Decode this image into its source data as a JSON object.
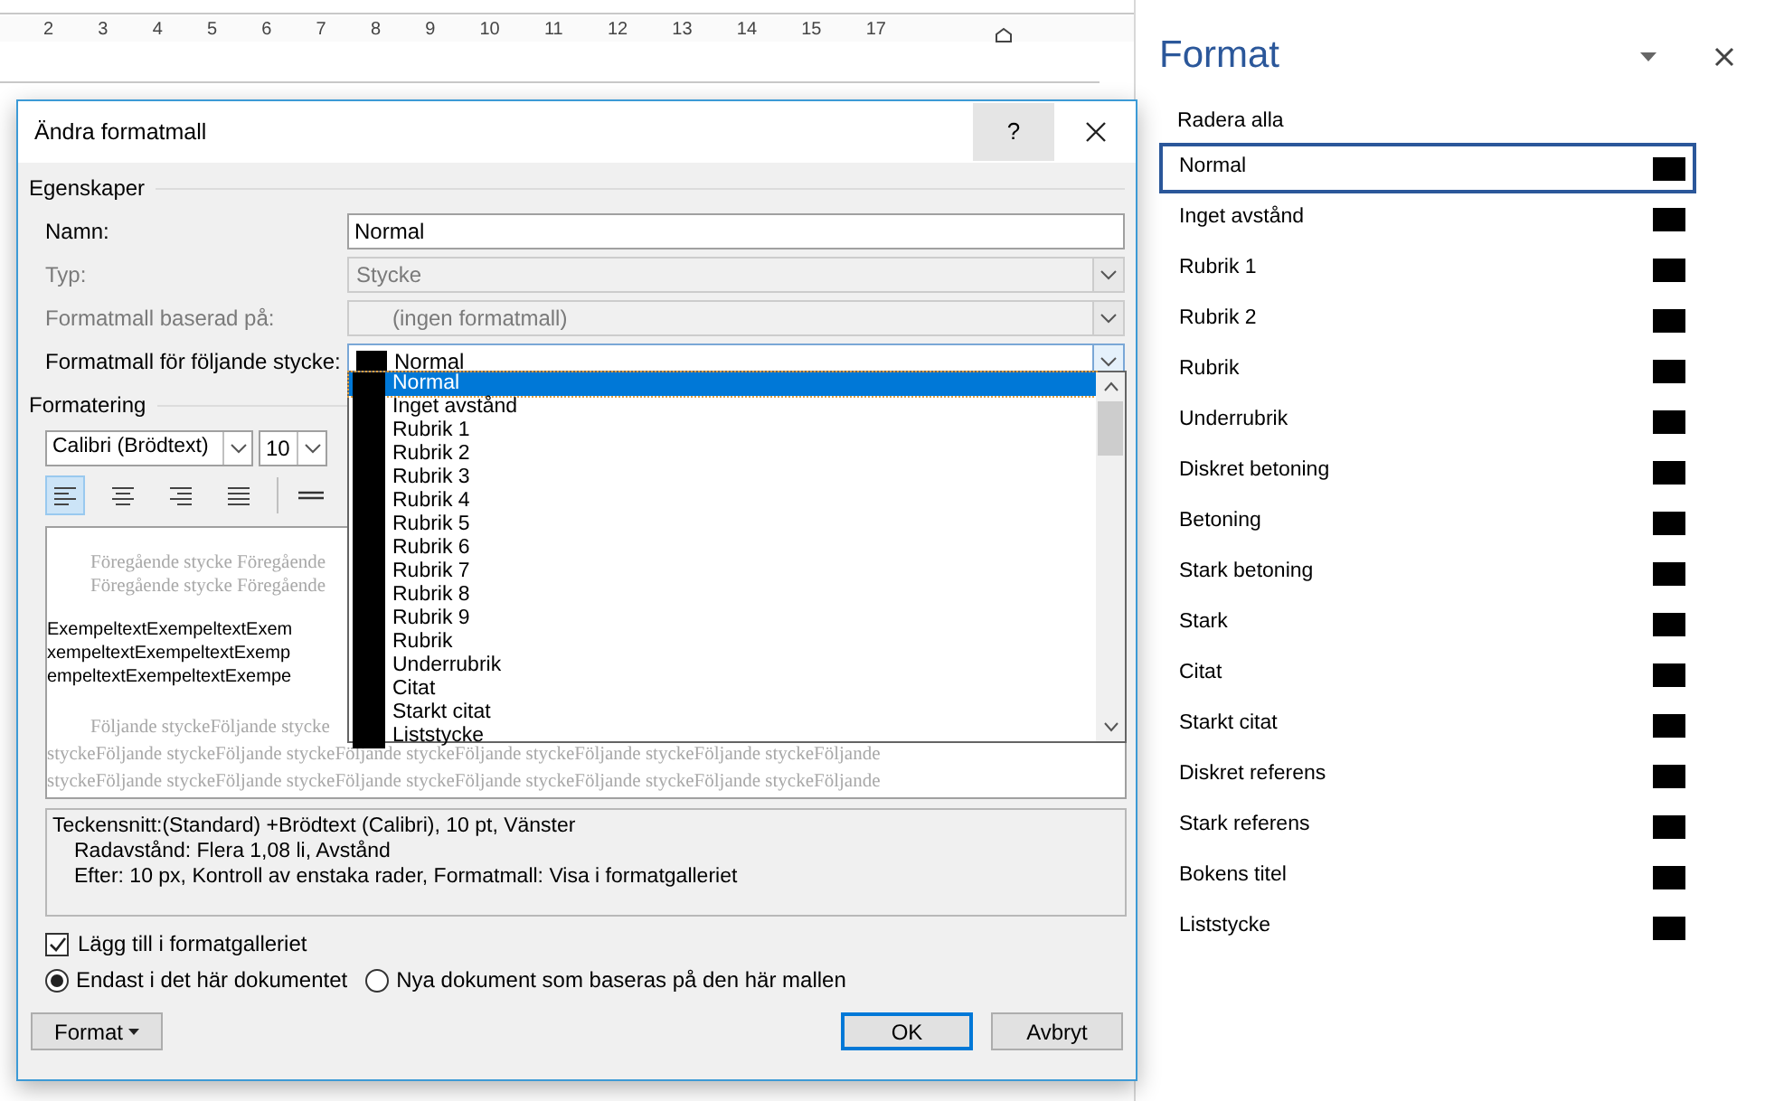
{
  "ruler": {
    "ticks": [
      "2",
      "3",
      "4",
      "5",
      "6",
      "7",
      "8",
      "9",
      "10",
      "11",
      "12",
      "13",
      "14",
      "15",
      "17"
    ]
  },
  "dialog": {
    "title": "Ändra formatmall",
    "help_button": "?",
    "properties": {
      "heading": "Egenskaper",
      "fields": [
        {
          "label": "Namn:",
          "value": "Normal",
          "kind": "text",
          "disabled": false
        },
        {
          "label": "Typ:",
          "value": "Stycke",
          "kind": "combo",
          "disabled": true
        },
        {
          "label": "Formatmall baserad på:",
          "value": "(ingen formatmall)",
          "kind": "combo",
          "disabled": true
        },
        {
          "label": "Formatmall för följande stycke:",
          "value": "Normal",
          "kind": "style-combo",
          "disabled": false
        }
      ]
    },
    "dropdown": {
      "items": [
        {
          "label": "Normal",
          "selected": true
        },
        {
          "label": "Inget avstånd",
          "selected": false
        },
        {
          "label": "Rubrik 1",
          "selected": false
        },
        {
          "label": "Rubrik 2",
          "selected": false
        },
        {
          "label": "Rubrik 3",
          "selected": false
        },
        {
          "label": "Rubrik 4",
          "selected": false
        },
        {
          "label": "Rubrik 5",
          "selected": false
        },
        {
          "label": "Rubrik 6",
          "selected": false
        },
        {
          "label": "Rubrik 7",
          "selected": false
        },
        {
          "label": "Rubrik 8",
          "selected": false
        },
        {
          "label": "Rubrik 9",
          "selected": false
        },
        {
          "label": "Rubrik",
          "selected": false
        },
        {
          "label": "Underrubrik",
          "selected": false
        },
        {
          "label": "Citat",
          "selected": false
        },
        {
          "label": "Starkt citat",
          "selected": false
        },
        {
          "label": "Liststycke",
          "selected": false
        }
      ]
    },
    "formatting": {
      "heading": "Formatering",
      "font": "Calibri (Brödtext)",
      "size": "10",
      "align_buttons": [
        {
          "kind": "left",
          "selected": true
        },
        {
          "kind": "center",
          "selected": false
        },
        {
          "kind": "right",
          "selected": false
        },
        {
          "kind": "justify",
          "selected": false
        }
      ]
    },
    "preview": {
      "lines": [
        {
          "kind": "previous",
          "text": "Föregående stycke Föregående"
        },
        {
          "kind": "previous",
          "text": "Föregående stycke Föregående"
        },
        {
          "kind": "sample",
          "text": "ExempeltextExempeltextExem"
        },
        {
          "kind": "sample",
          "text": "xempeltextExempeltextExemp"
        },
        {
          "kind": "sample",
          "text": "empeltextExempeltextExempe"
        },
        {
          "kind": "following",
          "text": "Följande styckeFöljande stycke"
        },
        {
          "kind": "following",
          "text": "styckeFöljande styckeFöljande styckeFöljande styckeFöljande styckeFöljande styckeFöljande styckeFöljande"
        },
        {
          "kind": "following",
          "text": "styckeFöljande styckeFöljande styckeFöljande styckeFöljande styckeFöljande styckeFöljande styckeFöljande"
        }
      ]
    },
    "description": [
      "Teckensnitt:(Standard) +Brödtext (Calibri), 10 pt, Vänster",
      "Radavstånd:  Flera 1,08 li, Avstånd",
      "Efter:  10 px, Kontroll av enstaka rader, Formatmall: Visa i formatgalleriet"
    ],
    "add_to_gallery": {
      "label": "Lägg till i formatgalleriet",
      "checked": true
    },
    "scope": [
      {
        "label": "Endast i det här dokumentet",
        "selected": true
      },
      {
        "label": "Nya dokument som baseras på den här mallen",
        "selected": false
      }
    ],
    "format_button": "Format",
    "ok_button": "OK",
    "cancel_button": "Avbryt"
  },
  "pane": {
    "title": "Format",
    "clear_all": "Radera alla",
    "styles": [
      {
        "label": "Normal",
        "selected": true
      },
      {
        "label": "Inget avstånd",
        "selected": false
      },
      {
        "label": "Rubrik 1",
        "selected": false
      },
      {
        "label": "Rubrik 2",
        "selected": false
      },
      {
        "label": "Rubrik",
        "selected": false
      },
      {
        "label": "Underrubrik",
        "selected": false
      },
      {
        "label": "Diskret betoning",
        "selected": false
      },
      {
        "label": "Betoning",
        "selected": false
      },
      {
        "label": "Stark betoning",
        "selected": false
      },
      {
        "label": "Stark",
        "selected": false
      },
      {
        "label": "Citat",
        "selected": false
      },
      {
        "label": "Starkt citat",
        "selected": false
      },
      {
        "label": "Diskret referens",
        "selected": false
      },
      {
        "label": "Stark referens",
        "selected": false
      },
      {
        "label": "Bokens titel",
        "selected": false
      },
      {
        "label": "Liststycke",
        "selected": false
      }
    ]
  }
}
